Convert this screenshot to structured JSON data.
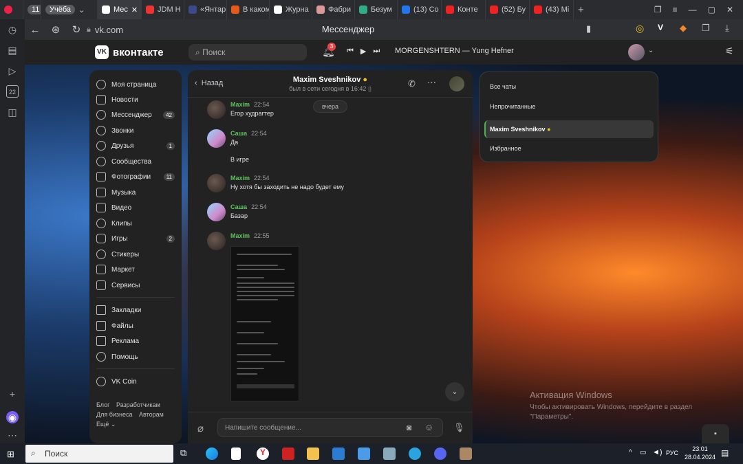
{
  "browser": {
    "tab_group_count": "11",
    "tabs": [
      {
        "label": "11",
        "group": true
      },
      {
        "label": "Учёба",
        "active": false
      },
      {
        "label": "Мес",
        "active": true
      },
      {
        "label": "JDM Н"
      },
      {
        "label": "«Янтар"
      },
      {
        "label": "В каком"
      },
      {
        "label": "Журна"
      },
      {
        "label": "Фабри"
      },
      {
        "label": "Безум"
      },
      {
        "label": "(13) Co"
      },
      {
        "label": "Конте"
      },
      {
        "label": "(52) Бу"
      },
      {
        "label": "(43) Мі"
      }
    ],
    "url": "vk.com",
    "page_title": "Мессенджер"
  },
  "vk": {
    "logo": "вконтакте",
    "search_placeholder": "Поиск",
    "notif_count": "3",
    "now_playing": "MORGENSHTERN — Yung Hefner"
  },
  "menu": {
    "items": [
      {
        "label": "Моя страница",
        "count": ""
      },
      {
        "label": "Новости",
        "count": ""
      },
      {
        "label": "Мессенджер",
        "count": "42"
      },
      {
        "label": "Звонки",
        "count": ""
      },
      {
        "label": "Друзья",
        "count": "1"
      },
      {
        "label": "Сообщества",
        "count": ""
      },
      {
        "label": "Фотографии",
        "count": "11"
      },
      {
        "label": "Музыка",
        "count": ""
      },
      {
        "label": "Видео",
        "count": ""
      },
      {
        "label": "Клипы",
        "count": ""
      },
      {
        "label": "Игры",
        "count": "2"
      },
      {
        "label": "Стикеры",
        "count": ""
      },
      {
        "label": "Маркет",
        "count": ""
      },
      {
        "label": "Сервисы",
        "count": ""
      },
      {
        "label": "Закладки",
        "count": ""
      },
      {
        "label": "Файлы",
        "count": ""
      },
      {
        "label": "Реклама",
        "count": ""
      },
      {
        "label": "Помощь",
        "count": ""
      },
      {
        "label": "VK Coin",
        "count": ""
      }
    ],
    "footer": {
      "blog": "Блог",
      "devs": "Разработчикам",
      "business": "Для бизнеса",
      "authors": "Авторам",
      "more": "Ещё"
    }
  },
  "chat": {
    "back": "Назад",
    "name": "Maxim Sveshnikov",
    "status": "был в сети сегодня в 16:42",
    "date_divider": "вчера",
    "messages": [
      {
        "author": "Maxim",
        "time": "22:54",
        "text": "Егор худрагтер"
      },
      {
        "author": "Саша",
        "time": "22:54",
        "text": "Да"
      },
      {
        "author": "",
        "time": "",
        "text": "В игре"
      },
      {
        "author": "Maxim",
        "time": "22:54",
        "text": "Ну хотя бы заходить не надо будет ему"
      },
      {
        "author": "Саша",
        "time": "22:54",
        "text": "Базар"
      },
      {
        "author": "Maxim",
        "time": "22:55",
        "text": ""
      }
    ],
    "input_placeholder": "Напишите сообщение..."
  },
  "chat_filters": {
    "items": [
      "Все чаты",
      "Непрочитанные",
      "Maxim Sveshnikov",
      "Избранное"
    ]
  },
  "windows": {
    "activation_title": "Активация Windows",
    "activation_text": "Чтобы активировать Windows, перейдите в раздел \"Параметры\".",
    "taskbar_search": "Поиск",
    "lang": "РУС",
    "time": "23:01",
    "date": "28.04.2024"
  }
}
